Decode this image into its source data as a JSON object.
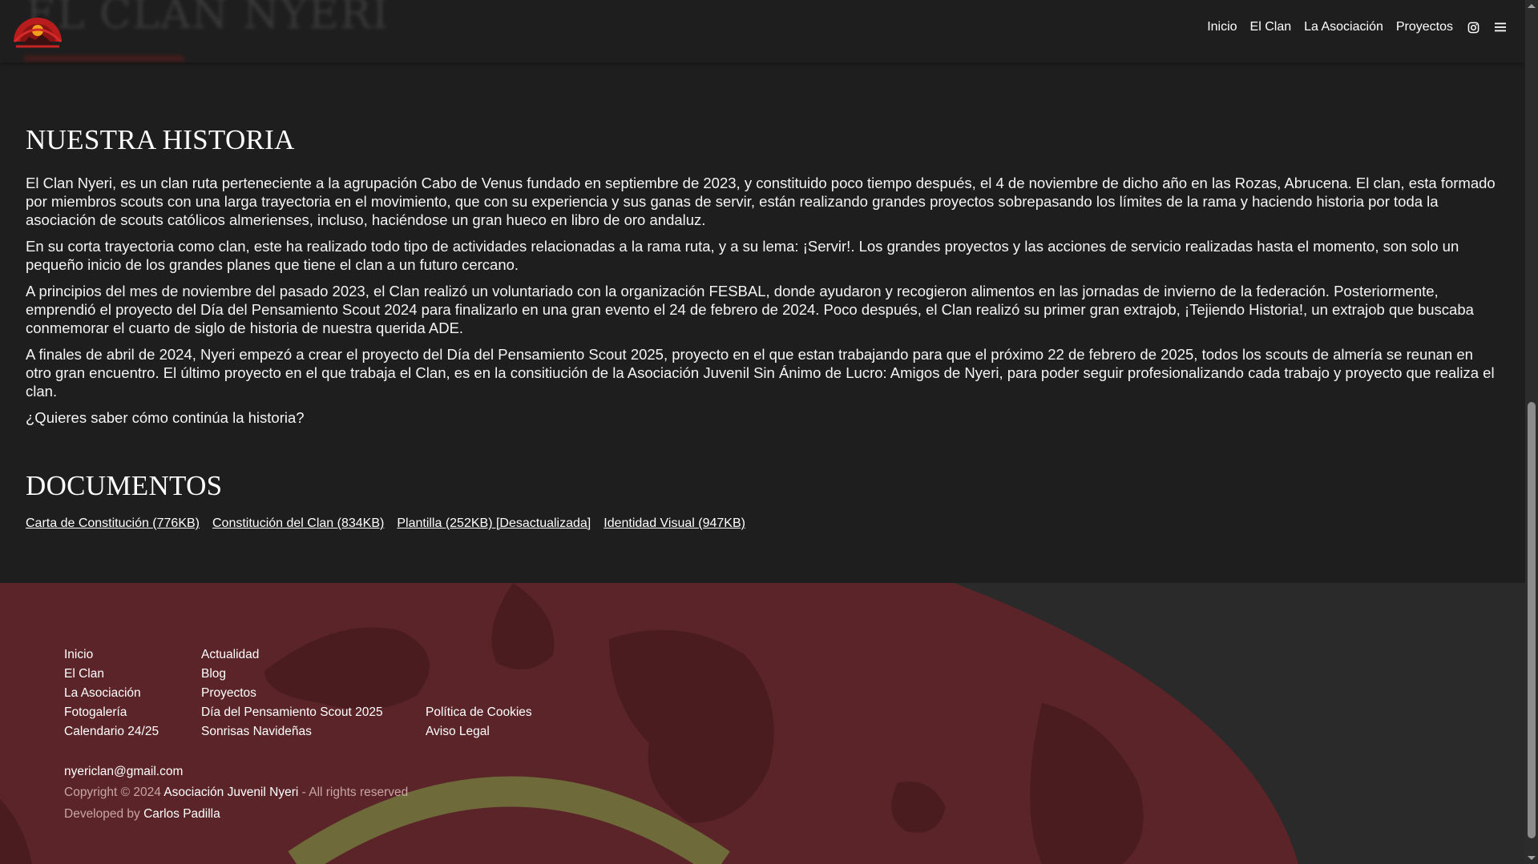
{
  "header": {
    "ghost_title": "EL CLAN NYERI",
    "nav": {
      "inicio": "Inicio",
      "el_clan": "El Clan",
      "la_asociacion": "La Asociación",
      "proyectos": "Proyectos"
    },
    "icons": [
      "instagram-icon",
      "menu-icon"
    ]
  },
  "history": {
    "title": "NUESTRA HISTORIA",
    "paragraphs": [
      "El Clan Nyeri, es un clan ruta perteneciente a la agrupación Cabo de Venus fundado en septiembre de 2023, y constituido poco tiempo después, el 4 de noviembre de dicho año en las Rozas, Abrucena. El clan, esta formado por miembros scouts con una larga trayectoria en el movimiento, que con su experiencia y sus ganas de servir, están realizando grandes proyectos sobrepasando los límites de la rama y haciendo historia por toda la asociación de scouts católicos almerienses, incluso, haciéndose un gran hueco en libro de oro andaluz.",
      "En su corta trayectoria como clan, este ha realizado todo tipo de actividades relacionadas a la rama ruta, y a su lema: ¡Servir!. Los grandes proyectos y las acciones de servicio realizadas hasta el momento, son solo un pequeño inicio de los grandes planes que tiene el clan a un futuro cercano.",
      "A principios del mes de noviembre del pasado 2023, el Clan realizó un voluntariado con la organización FESBAL, donde ayudaron y recogieron alimentos en las jornadas de invierno de la federación. Posteriormente, emprendió el proyecto del Día del Pensamiento Scout 2024 para finalizarlo en una gran evento el 24 de febrero de 2024. Poco después, el Clan realizó su primer gran extrajob, ¡Tejiendo Historia!, un extrajob que buscaba conmemorar el cuarto de siglo de historia de nuestra querida ADE.",
      "A finales de abril de 2024, Nyeri empezó a crear el proyecto del Día del Pensamiento Scout 2025, proyecto en el que estan trabajando para que el próximo 22 de febrero de 2025, todos los scouts de almería se reunan en otro gran encuentro. El último proyecto en el que trabaja el Clan, es en la consitiución de la Asociación Juvenil Sin Ánimo de Lucro: Amigos de Nyeri, para poder seguir profesionalizando cada trabajo y proyecto que realiza el clan.",
      "¿Quieres saber cómo continúa la historia?"
    ]
  },
  "documents": {
    "title": "DOCUMENTOS",
    "links": [
      "Carta de Constitución (776KB)",
      "Constitución del Clan (834KB)",
      "Plantilla (252KB) [Desactualizada]",
      "Identidad Visual (947KB)"
    ]
  },
  "footer": {
    "col1": [
      "Inicio",
      "El Clan",
      "La Asociación",
      "Fotogalería",
      "Calendario 24/25"
    ],
    "col2": [
      "Actualidad",
      "Blog",
      "Proyectos",
      "Día del Pensamiento Scout 2025",
      "Sonrisas Navideñas"
    ],
    "col3": [
      "Política de Cookies",
      "Aviso Legal"
    ],
    "email": "nyericlan@gmail.com",
    "copyright_prefix": "Copyright © 2024",
    "copyright_org": "Asociación Juvenil Nyeri",
    "copyright_suffix": "- All rights reserved",
    "developed_prefix": "Developed by",
    "developer": "Carlos Padilla"
  },
  "colors": {
    "background": "#1e1e1e",
    "footer_red": "#5a2428",
    "accent_gold": "#6e6a3a",
    "text": "#ffffff"
  }
}
